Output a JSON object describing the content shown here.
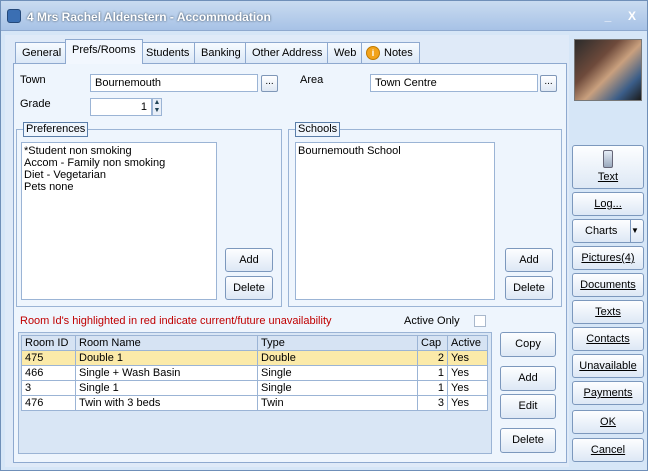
{
  "window": {
    "title": "4 Mrs Rachel Aldenstern - Accommodation",
    "min": "_",
    "close": "X"
  },
  "tabs": [
    "General",
    "Prefs/Rooms",
    "Students",
    "Banking",
    "Other Address",
    "Web",
    "Notes"
  ],
  "form": {
    "town_label": "Town",
    "town_value": "Bournemouth",
    "area_label": "Area",
    "area_value": "Town Centre",
    "grade_label": "Grade",
    "grade_value": "1",
    "dots": "..."
  },
  "preferences": {
    "title": "Preferences",
    "items": [
      "*Student non smoking",
      "Accom - Family non smoking",
      "Diet - Vegetarian",
      "Pets none"
    ],
    "add": "Add",
    "delete": "Delete"
  },
  "schools": {
    "title": "Schools",
    "items": [
      "Bournemouth School"
    ],
    "add": "Add",
    "delete": "Delete"
  },
  "rooms": {
    "warning": "Room Id's highlighted in red indicate current/future unavailability",
    "active_only": "Active Only",
    "columns": [
      "Room ID",
      "Room Name",
      "Type",
      "Cap",
      "Active"
    ],
    "rows": [
      [
        "475",
        "Double 1",
        "Double",
        "2",
        "Yes"
      ],
      [
        "466",
        "Single + Wash Basin",
        "Single",
        "1",
        "Yes"
      ],
      [
        "3",
        "Single 1",
        "Single",
        "1",
        "Yes"
      ],
      [
        "476",
        "Twin with 3 beds",
        "Twin",
        "3",
        "Yes"
      ]
    ],
    "copy": "Copy",
    "add": "Add",
    "edit": "Edit",
    "delete": "Delete"
  },
  "sidebar": {
    "text": "Text",
    "log": "Log...",
    "charts": "Charts",
    "pictures": "Pictures(4)",
    "documents": "Documents",
    "texts": "Texts",
    "contacts": "Contacts",
    "unavailable": "Unavailable",
    "payments": "Payments",
    "ok": "OK",
    "cancel": "Cancel"
  }
}
